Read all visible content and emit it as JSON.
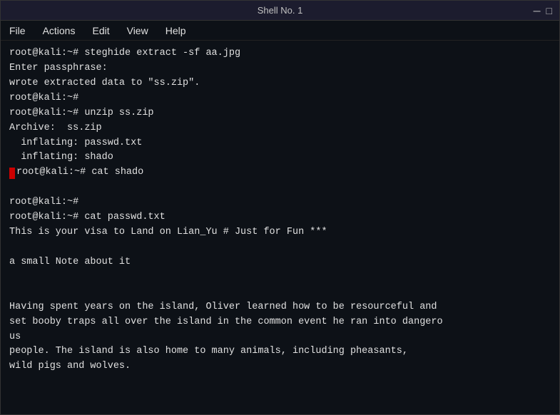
{
  "window": {
    "title": "Shell No. 1",
    "min_btn": "─",
    "max_btn": "□"
  },
  "menu": {
    "items": [
      "File",
      "Actions",
      "Edit",
      "View",
      "Help"
    ]
  },
  "terminal": {
    "lines": [
      {
        "text": "root@kali:~# steghide extract -sf aa.jpg",
        "type": "normal"
      },
      {
        "text": "Enter passphrase:",
        "type": "normal"
      },
      {
        "text": "wrote extracted data to \"ss.zip\".",
        "type": "normal"
      },
      {
        "text": "root@kali:~#",
        "type": "normal"
      },
      {
        "text": "root@kali:~# unzip ss.zip",
        "type": "normal"
      },
      {
        "text": "Archive:  ss.zip",
        "type": "normal"
      },
      {
        "text": "  inflating: passwd.txt",
        "type": "normal"
      },
      {
        "text": "  inflating: shado",
        "type": "normal"
      },
      {
        "text": "root@kali:~# cat shado",
        "type": "highlight"
      },
      {
        "text": "",
        "type": "empty"
      },
      {
        "text": "root@kali:~#",
        "type": "normal"
      },
      {
        "text": "root@kali:~# cat passwd.txt",
        "type": "normal"
      },
      {
        "text": "This is your visa to Land on Lian_Yu # Just for Fun ***",
        "type": "normal"
      },
      {
        "text": "",
        "type": "empty"
      },
      {
        "text": "a small Note about it",
        "type": "normal"
      },
      {
        "text": "",
        "type": "empty"
      },
      {
        "text": "",
        "type": "empty"
      },
      {
        "text": "Having spent years on the island, Oliver learned how to be resourceful and",
        "type": "normal"
      },
      {
        "text": "set booby traps all over the island in the common event he ran into dangero",
        "type": "normal"
      },
      {
        "text": "us",
        "type": "normal"
      },
      {
        "text": "people. The island is also home to many animals, including pheasants,",
        "type": "normal"
      },
      {
        "text": "wild pigs and wolves.",
        "type": "normal"
      }
    ]
  }
}
